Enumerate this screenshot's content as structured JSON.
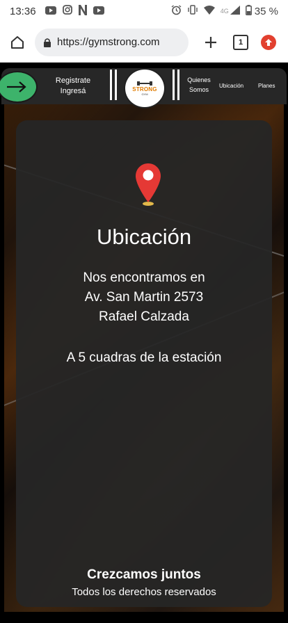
{
  "status_bar": {
    "time": "13:36",
    "network": "4G",
    "battery": "35 %"
  },
  "browser": {
    "url": "https://gymstrong.com",
    "tab_count": "1"
  },
  "navbar": {
    "register_line1": "Registrate",
    "register_line2": "Ingresá",
    "logo_text": "STRONG",
    "logo_sub": "GYM",
    "about_line1": "Quienes",
    "about_line2": "Somos",
    "location": "Ubicación",
    "plans": "Planes"
  },
  "card": {
    "title": "Ubicación",
    "address_line1": "Nos encontramos en",
    "address_line2": "Av. San Martin 2573",
    "address_line3": "Rafael Calzada",
    "note": "A 5 cuadras de la estación",
    "footer_title": "Crezcamos juntos",
    "footer_sub": "Todos los derechos reservados"
  },
  "colors": {
    "accent_green": "#3db36b",
    "pin_red": "#e53935",
    "logo_orange": "#e07b00"
  }
}
